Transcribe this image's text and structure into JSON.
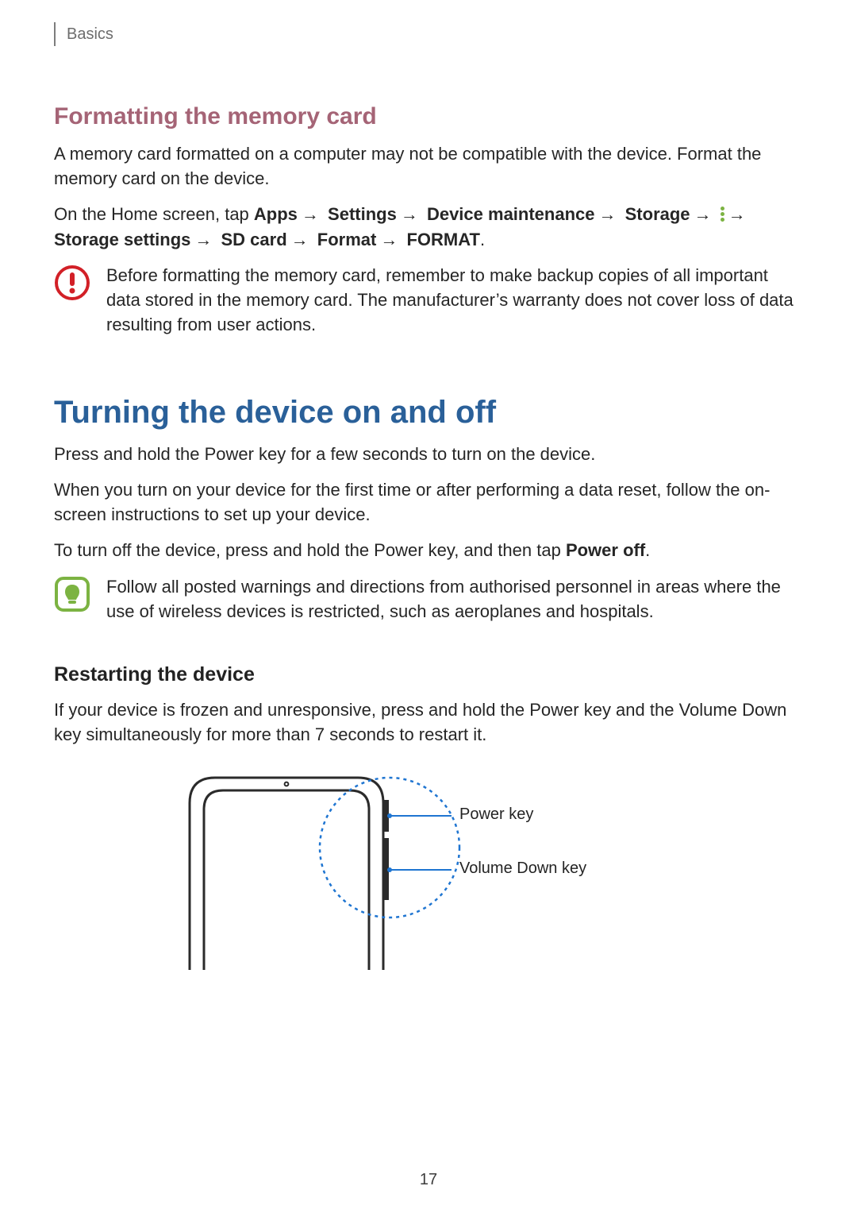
{
  "header": {
    "chapter": "Basics"
  },
  "s1": {
    "title": "Formatting the memory card",
    "p1": "A memory card formatted on a computer may not be compatible with the device. Format the memory card on the device.",
    "lead": "On the Home screen, tap ",
    "path": [
      "Apps",
      "Settings",
      "Device maintenance",
      "Storage"
    ],
    "path2": [
      "Storage settings",
      "SD card",
      "Format",
      "FORMAT"
    ],
    "warn": "Before formatting the memory card, remember to make backup copies of all important data stored in the memory card. The manufacturer’s warranty does not cover loss of data resulting from user actions."
  },
  "s2": {
    "title": "Turning the device on and off",
    "p1": "Press and hold the Power key for a few seconds to turn on the device.",
    "p2": "When you turn on your device for the first time or after performing a data reset, follow the on-screen instructions to set up your device.",
    "p3_a": "To turn off the device, press and hold the Power key, and then tap ",
    "p3_b": "Power off",
    "p3_c": ".",
    "note": "Follow all posted warnings and directions from authorised personnel in areas where the use of wireless devices is restricted, such as aeroplanes and hospitals."
  },
  "s3": {
    "title": "Restarting the device",
    "p1": "If your device is frozen and unresponsive, press and hold the Power key and the Volume Down key simultaneously for more than 7 seconds to restart it.",
    "label_power": "Power key",
    "label_vol": "Volume Down key"
  },
  "page_number": "17",
  "colors": {
    "accent_h2": "#a56476",
    "accent_h1": "#2a6099",
    "warn": "#d22027",
    "note": "#7cb342",
    "dash": "#1f75d1"
  }
}
